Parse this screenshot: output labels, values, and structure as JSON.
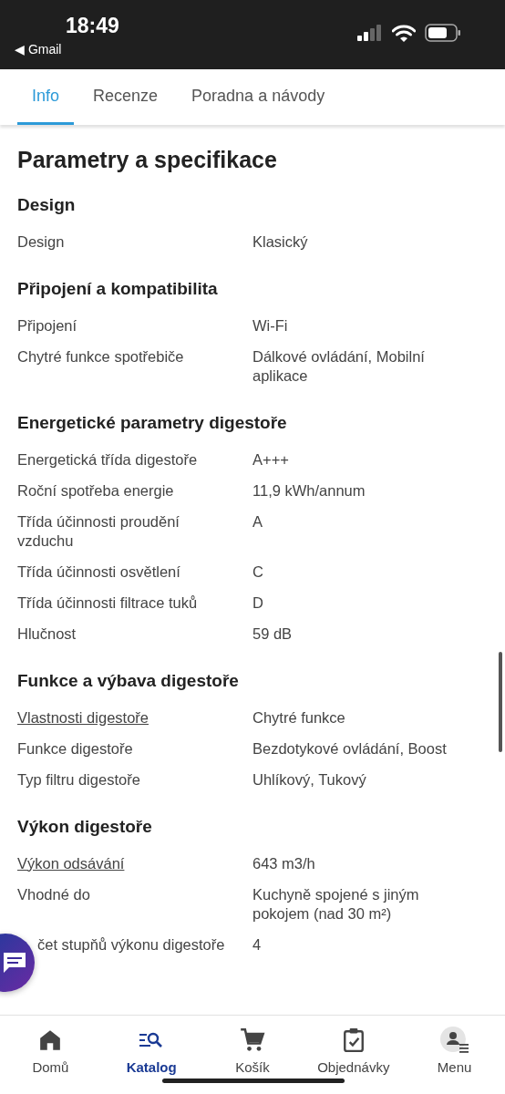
{
  "status_bar": {
    "time": "18:49",
    "back_label": "◀ Gmail"
  },
  "tabs": [
    {
      "label": "Info",
      "selected": true
    },
    {
      "label": "Recenze",
      "selected": false
    },
    {
      "label": "Poradna a návody",
      "selected": false
    }
  ],
  "title": "Parametry a specifikace",
  "sections": [
    {
      "heading": "Design",
      "rows": [
        {
          "label": "Design",
          "value": "Klasický",
          "link": false
        }
      ]
    },
    {
      "heading": "Připojení a kompatibilita",
      "rows": [
        {
          "label": "Připojení",
          "value": "Wi-Fi",
          "link": false
        },
        {
          "label": "Chytré funkce spotřebiče",
          "value": "Dálkové ovládání, Mobilní aplikace",
          "link": false
        }
      ]
    },
    {
      "heading": "Energetické parametry digestoře",
      "rows": [
        {
          "label": "Energetická třída digestoře",
          "value": "A+++",
          "link": false
        },
        {
          "label": "Roční spotřeba energie",
          "value": "11,9 kWh/annum",
          "link": false
        },
        {
          "label": "Třída účinnosti proudění vzduchu",
          "value": "A",
          "link": false
        },
        {
          "label": "Třída účinnosti osvětlení",
          "value": "C",
          "link": false
        },
        {
          "label": "Třída účinnosti filtrace tuků",
          "value": "D",
          "link": false
        },
        {
          "label": "Hlučnost",
          "value": "59 dB",
          "link": false
        }
      ]
    },
    {
      "heading": "Funkce a výbava digestoře",
      "rows": [
        {
          "label": "Vlastnosti digestoře",
          "value": "Chytré funkce",
          "link": true
        },
        {
          "label": "Funkce digestoře",
          "value": "Bezdotykové ovládání, Boost",
          "link": false
        },
        {
          "label": "Typ filtru digestoře",
          "value": "Uhlíkový, Tukový",
          "link": false
        }
      ]
    },
    {
      "heading": "Výkon digestoře",
      "rows": [
        {
          "label": "Výkon odsávání",
          "value": "643 m3/h",
          "link": true
        },
        {
          "label": "Vhodné do",
          "value": "Kuchyně spojené s jiným pokojem (nad 30 m²)",
          "link": false
        },
        {
          "label": "čet stupňů výkonu digestoře",
          "value": "4",
          "link": false,
          "covered": true
        }
      ]
    }
  ],
  "nav": [
    {
      "kind": "home",
      "label": "Domů",
      "selected": false
    },
    {
      "kind": "catalog",
      "label": "Katalog",
      "selected": true
    },
    {
      "kind": "cart",
      "label": "Košík",
      "selected": false
    },
    {
      "kind": "orders",
      "label": "Objednávky",
      "selected": false
    },
    {
      "kind": "menu",
      "label": "Menu",
      "selected": false
    }
  ]
}
